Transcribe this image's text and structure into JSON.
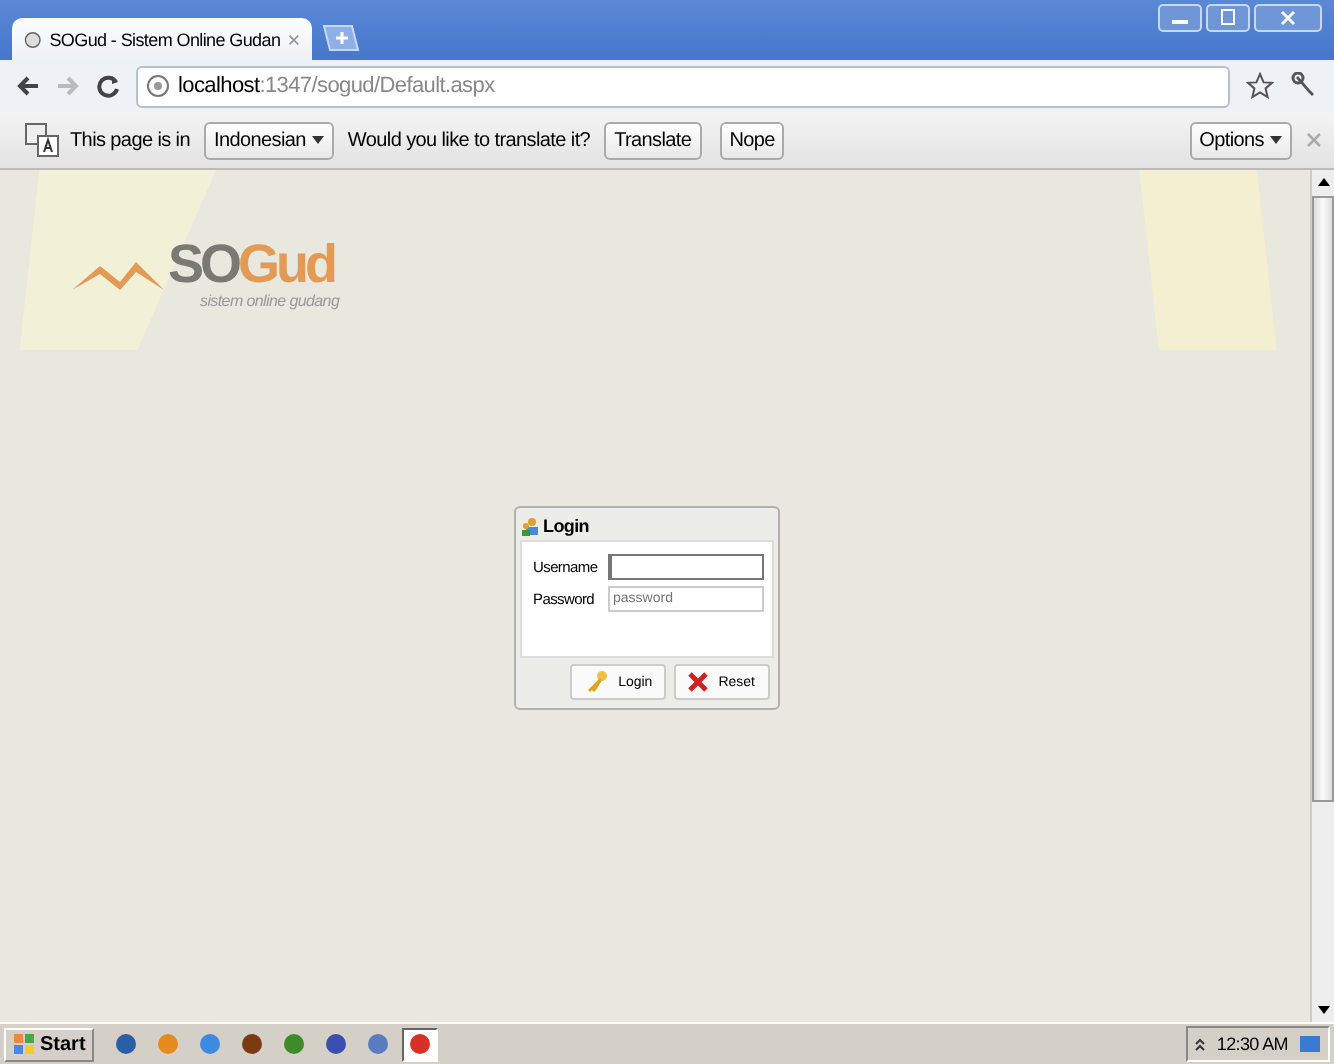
{
  "tab": {
    "title": "SOGud - Sistem Online Gudan"
  },
  "address": {
    "host": "localhost",
    "path": ":1347/sogud/Default.aspx"
  },
  "translate_bar": {
    "prefix": "This page is in",
    "language": "Indonesian",
    "question": "Would you like to translate it?",
    "buttons": [
      "Translate",
      "Nope"
    ],
    "options": "Options"
  },
  "logo": {
    "part_1": "SO",
    "part_2": "Gud",
    "tagline": "sistem online gudang"
  },
  "login": {
    "title": "Login",
    "fields": [
      {
        "label": "Username",
        "focused": true
      },
      {
        "label": "Password",
        "placeholder": "password",
        "focused": false
      }
    ],
    "buttons": [
      {
        "label": "Login",
        "kind": "key"
      },
      {
        "label": "Reset",
        "kind": "cross"
      }
    ]
  },
  "taskbar": {
    "start": "Start",
    "apps": [
      {
        "selected": false
      },
      {
        "selected": false
      },
      {
        "selected": false
      },
      {
        "selected": false
      },
      {
        "selected": false
      },
      {
        "selected": false
      },
      {
        "selected": false
      },
      {
        "selected": true
      }
    ],
    "clock": "12:30 AM"
  }
}
